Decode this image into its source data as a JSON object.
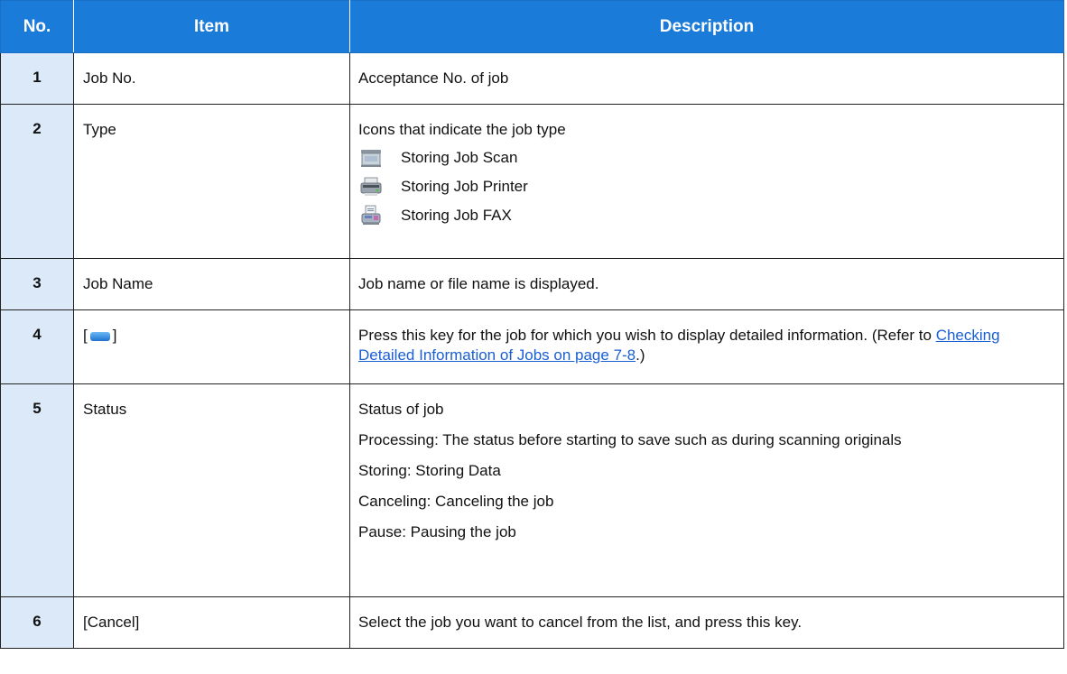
{
  "headers": {
    "no": "No.",
    "item": "Item",
    "description": "Description"
  },
  "rows": [
    {
      "no": "1",
      "item": "Job No.",
      "desc": "Acceptance No. of job"
    },
    {
      "no": "2",
      "item": "Type",
      "desc": "Icons that indicate the job type",
      "types": [
        {
          "icon": "scanner-icon",
          "label": "Storing Job Scan"
        },
        {
          "icon": "printer-icon",
          "label": "Storing Job Printer"
        },
        {
          "icon": "fax-icon",
          "label": "Storing Job FAX"
        }
      ]
    },
    {
      "no": "3",
      "item": "Job Name",
      "desc": "Job name or file name is displayed."
    },
    {
      "no": "4",
      "item_open": "[",
      "item_close": "]",
      "item_icon": "detail-key-icon",
      "desc_pre": "Press this key for the job for which you wish to display detailed information. (Refer to ",
      "link": "Checking Detailed Information of Jobs on page 7-8",
      "desc_post": ".)"
    },
    {
      "no": "5",
      "item": "Status",
      "lines": [
        "Status of job",
        "Processing: The status before starting to save such as during scanning originals",
        "Storing: Storing Data",
        "Canceling: Canceling the job",
        "Pause: Pausing the job"
      ]
    },
    {
      "no": "6",
      "item": "[Cancel]",
      "desc": "Select the job you want to cancel from the list, and press this key."
    }
  ],
  "colors": {
    "header_bg": "#1a7bd9",
    "no_col_bg": "#dbe9f8",
    "link": "#1a5fd4"
  }
}
